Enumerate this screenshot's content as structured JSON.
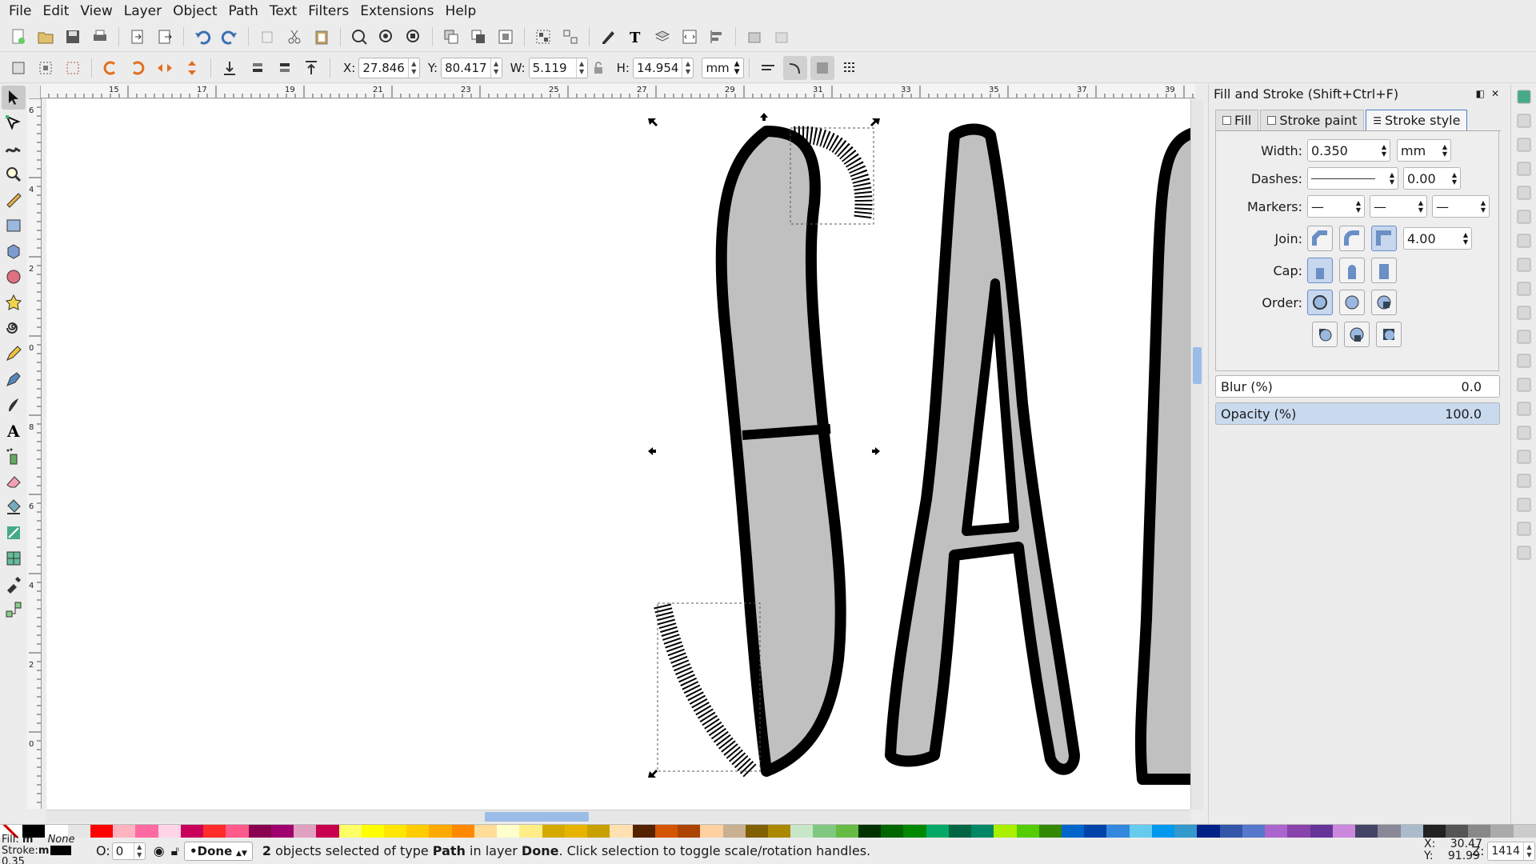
{
  "menu": [
    "File",
    "Edit",
    "View",
    "Layer",
    "Object",
    "Path",
    "Text",
    "Filters",
    "Extensions",
    "Help"
  ],
  "ctrl": {
    "x_label": "X:",
    "x_value": "27.846",
    "y_label": "Y:",
    "y_value": "80.417",
    "w_label": "W:",
    "w_value": "5.119",
    "h_label": "H:",
    "h_value": "14.954",
    "unit": "mm"
  },
  "ruler": {
    "top": [
      "15",
      "17",
      "19",
      "21",
      "23",
      "25",
      "27",
      "29",
      "31",
      "33",
      "35",
      "37",
      "39"
    ],
    "left": [
      "6",
      "4",
      "2",
      "0",
      "8",
      "6",
      "4",
      "2",
      "0"
    ]
  },
  "canvas": {
    "letters": "SAI"
  },
  "panel": {
    "title": "Fill and Stroke (Shift+Ctrl+F)",
    "tabs": [
      "Fill",
      "Stroke paint",
      "Stroke style"
    ],
    "width_label": "Width:",
    "width_value": "0.350",
    "width_unit": "mm",
    "dashes_label": "Dashes:",
    "dashes_offset": "0.00",
    "markers_label": "Markers:",
    "join_label": "Join:",
    "miter_value": "4.00",
    "cap_label": "Cap:",
    "order_label": "Order:",
    "blur_label": "Blur (%)",
    "blur_value": "0.0",
    "opacity_label": "Opacity (%)",
    "opacity_value": "100.0"
  },
  "palette": [
    "#000000",
    "#ffffff",
    "#e6e6e6",
    "#ff0000",
    "#ffb3c1",
    "#ff6aa3",
    "#ffd5e5",
    "#c8005a",
    "#ff2a2a",
    "#ff5a8c",
    "#8a0050",
    "#a0006e",
    "#e0a0c0",
    "#c80050",
    "#ffff66",
    "#ffff00",
    "#ffe600",
    "#ffcc00",
    "#ffaa00",
    "#ff8800",
    "#ffdd99",
    "#ffffcc",
    "#ffee88",
    "#d4aa00",
    "#e6b400",
    "#c8a000",
    "#ffe0b0",
    "#552200",
    "#d45500",
    "#aa4400",
    "#ffd0a0",
    "#c8b090",
    "#806000",
    "#aa8800",
    "#c8e6c8",
    "#80c880",
    "#66bb44",
    "#003300",
    "#006600",
    "#008800",
    "#00aa66",
    "#006644",
    "#008866",
    "#aaee00",
    "#55cc00",
    "#338800",
    "#0066cc",
    "#0044aa",
    "#3388dd",
    "#66ccee",
    "#0099ee",
    "#3399cc",
    "#002288",
    "#3355aa",
    "#5577cc",
    "#aa66cc",
    "#8844aa",
    "#663399",
    "#cc88dd",
    "#444466",
    "#888899",
    "#aabbcc",
    "#222222",
    "#555555",
    "#888888",
    "#aaaaaa",
    "#cccccc"
  ],
  "status": {
    "fill_label": "Fill:",
    "fill_value": "m",
    "fill_none": "None",
    "stroke_label": "Stroke:",
    "stroke_value": "m",
    "stroke_width": "0.35",
    "opacity_label": "O:",
    "opacity_value": "0",
    "layer": "•Done",
    "msg_count": "2",
    "msg_a": " objects selected of type ",
    "msg_type": "Path",
    "msg_b": " in layer ",
    "msg_layer": "Done",
    "msg_c": ". Click selection to toggle scale/rotation handles.",
    "cursor_x_label": "X:",
    "cursor_x": "30.47",
    "cursor_y_label": "Y:",
    "cursor_y": "91.99",
    "zoom_label": "Z:",
    "zoom": "1414"
  }
}
